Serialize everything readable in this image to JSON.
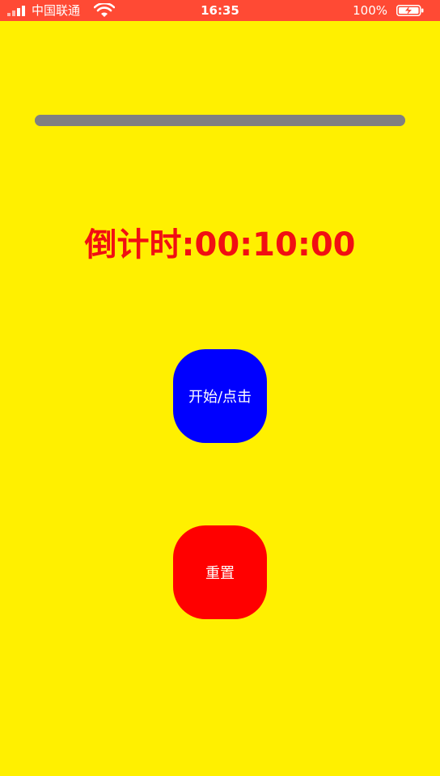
{
  "status_bar": {
    "carrier": "中国联通",
    "time": "16:35",
    "battery_percent": "100%",
    "signal_icon": "signal-bars-icon",
    "wifi_icon": "wifi-icon",
    "battery_icon": "battery-charging-icon",
    "background_color": "#ff4a34"
  },
  "progress": {
    "value": 1.0,
    "color": "#808080"
  },
  "countdown": {
    "label": "倒计时:",
    "value": "00:10:00",
    "color": "#f10f12"
  },
  "buttons": {
    "start": {
      "label": "开始/点击",
      "color": "#0000ff"
    },
    "reset": {
      "label": "重置",
      "color": "#ff0000"
    }
  },
  "colors": {
    "background": "#fff000"
  }
}
